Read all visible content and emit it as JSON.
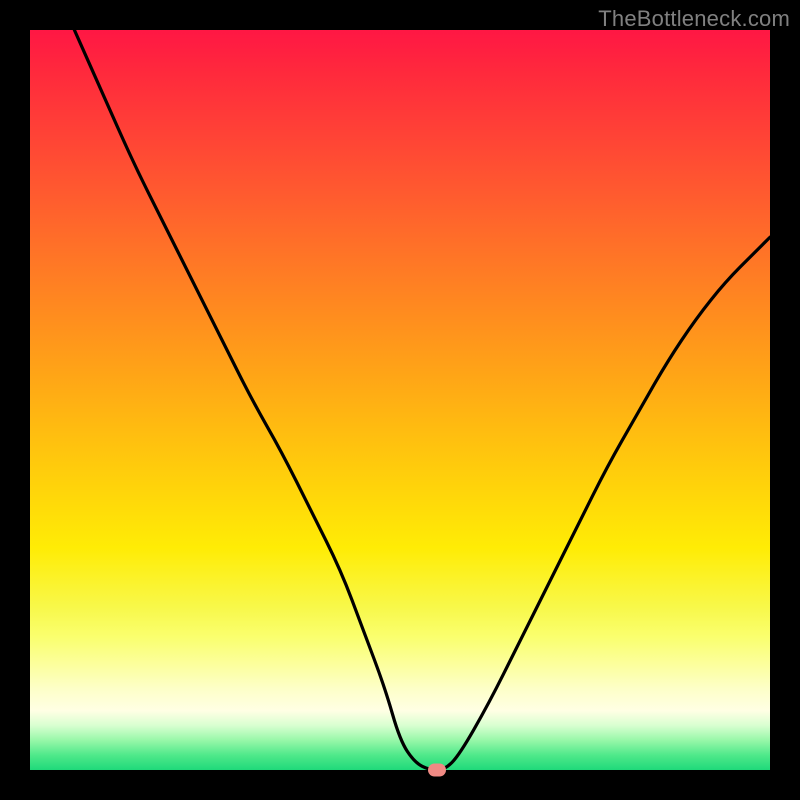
{
  "watermark": "TheBottleneck.com",
  "chart_data": {
    "type": "line",
    "title": "",
    "xlabel": "",
    "ylabel": "",
    "x_range": [
      0,
      100
    ],
    "y_range": [
      0,
      100
    ],
    "background": "heatmap-gradient",
    "gradient_stops": [
      {
        "pos": 0,
        "color": "#ff1744"
      },
      {
        "pos": 50,
        "color": "#ffbc10"
      },
      {
        "pos": 80,
        "color": "#faff6e"
      },
      {
        "pos": 100,
        "color": "#1fd97a"
      }
    ],
    "series": [
      {
        "name": "bottleneck-curve",
        "color": "#000000",
        "x": [
          6,
          10,
          14,
          18,
          22,
          26,
          30,
          34,
          38,
          42,
          45,
          48,
          50,
          52,
          54,
          56,
          58,
          62,
          66,
          70,
          74,
          78,
          82,
          86,
          90,
          94,
          98,
          100
        ],
        "y": [
          100,
          91,
          82,
          74,
          66,
          58,
          50,
          43,
          35,
          27,
          19,
          11,
          4,
          1,
          0,
          0,
          2,
          9,
          17,
          25,
          33,
          41,
          48,
          55,
          61,
          66,
          70,
          72
        ]
      }
    ],
    "marker": {
      "x": 55,
      "y": 0,
      "color": "#f08a84"
    }
  }
}
